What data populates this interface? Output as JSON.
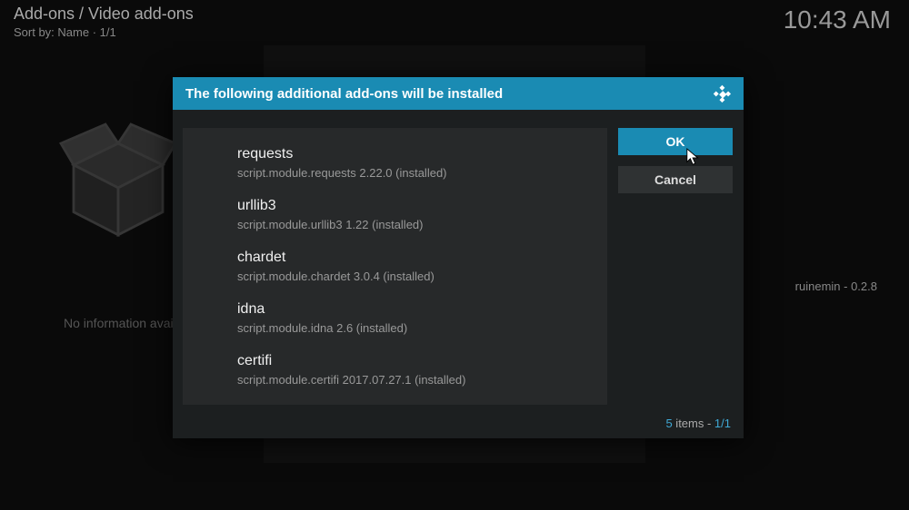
{
  "header": {
    "breadcrumb": "Add-ons / Video add-ons",
    "sort_label": "Sort by: Name",
    "sort_page": "1/1",
    "clock": "10:43 AM"
  },
  "background": {
    "no_info": "No information available",
    "addon_label": "ruinemin - 0.2.8"
  },
  "dialog": {
    "title": "The following additional add-ons will be installed",
    "buttons": {
      "ok": "OK",
      "cancel": "Cancel"
    },
    "addons": [
      {
        "name": "requests",
        "detail": "script.module.requests 2.22.0 (installed)"
      },
      {
        "name": "urllib3",
        "detail": "script.module.urllib3 1.22 (installed)"
      },
      {
        "name": "chardet",
        "detail": "script.module.chardet 3.0.4 (installed)"
      },
      {
        "name": "idna",
        "detail": "script.module.idna 2.6 (installed)"
      },
      {
        "name": "certifi",
        "detail": "script.module.certifi 2017.07.27.1 (installed)"
      }
    ],
    "footer": {
      "count": "5",
      "items_word": " items - ",
      "page": "1/1"
    }
  }
}
